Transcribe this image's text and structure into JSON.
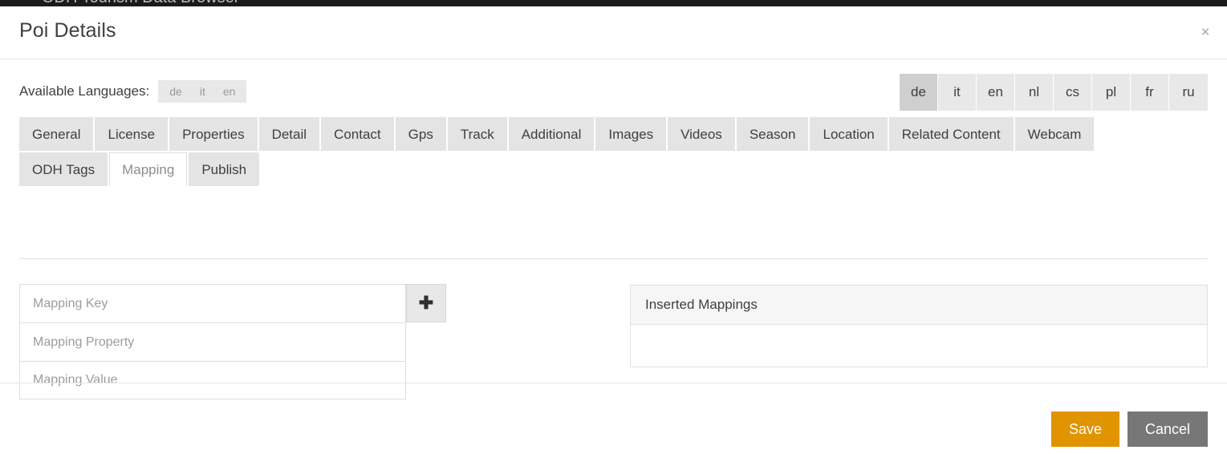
{
  "app": {
    "title": "ODH Tourism Data Browser"
  },
  "modal": {
    "title": "Poi Details",
    "close_label": "×"
  },
  "languages": {
    "label": "Available Languages:",
    "available": [
      "de",
      "it",
      "en"
    ],
    "switch": [
      {
        "code": "de",
        "active": true
      },
      {
        "code": "it",
        "active": false
      },
      {
        "code": "en",
        "active": false
      },
      {
        "code": "nl",
        "active": false
      },
      {
        "code": "cs",
        "active": false
      },
      {
        "code": "pl",
        "active": false
      },
      {
        "code": "fr",
        "active": false
      },
      {
        "code": "ru",
        "active": false
      }
    ]
  },
  "tabs": {
    "row1": [
      {
        "label": "General",
        "active": false
      },
      {
        "label": "License",
        "active": false
      },
      {
        "label": "Properties",
        "active": false
      },
      {
        "label": "Detail",
        "active": false
      },
      {
        "label": "Contact",
        "active": false
      },
      {
        "label": "Gps",
        "active": false
      },
      {
        "label": "Track",
        "active": false
      },
      {
        "label": "Additional",
        "active": false
      },
      {
        "label": "Images",
        "active": false
      },
      {
        "label": "Videos",
        "active": false
      },
      {
        "label": "Season",
        "active": false
      },
      {
        "label": "Location",
        "active": false
      },
      {
        "label": "Related Content",
        "active": false
      },
      {
        "label": "Webcam",
        "active": false
      }
    ],
    "row2": [
      {
        "label": "ODH Tags",
        "active": false
      },
      {
        "label": "Mapping",
        "active": true
      },
      {
        "label": "Publish",
        "active": false
      }
    ]
  },
  "mapping_form": {
    "key_placeholder": "Mapping Key",
    "key_value": "",
    "property_placeholder": "Mapping Property",
    "property_value": "",
    "value_placeholder": "Mapping Value",
    "value_value": "",
    "add_label": "✚"
  },
  "inserted_mappings": {
    "header": "Inserted Mappings",
    "rows": []
  },
  "footer": {
    "save_label": "Save",
    "cancel_label": "Cancel"
  },
  "colors": {
    "accent_save": "#e09400",
    "cancel": "#777777",
    "tab_inactive": "#e4e4e4",
    "lang_active": "#cfcfcf",
    "app_bar": "#1b1b1b"
  }
}
